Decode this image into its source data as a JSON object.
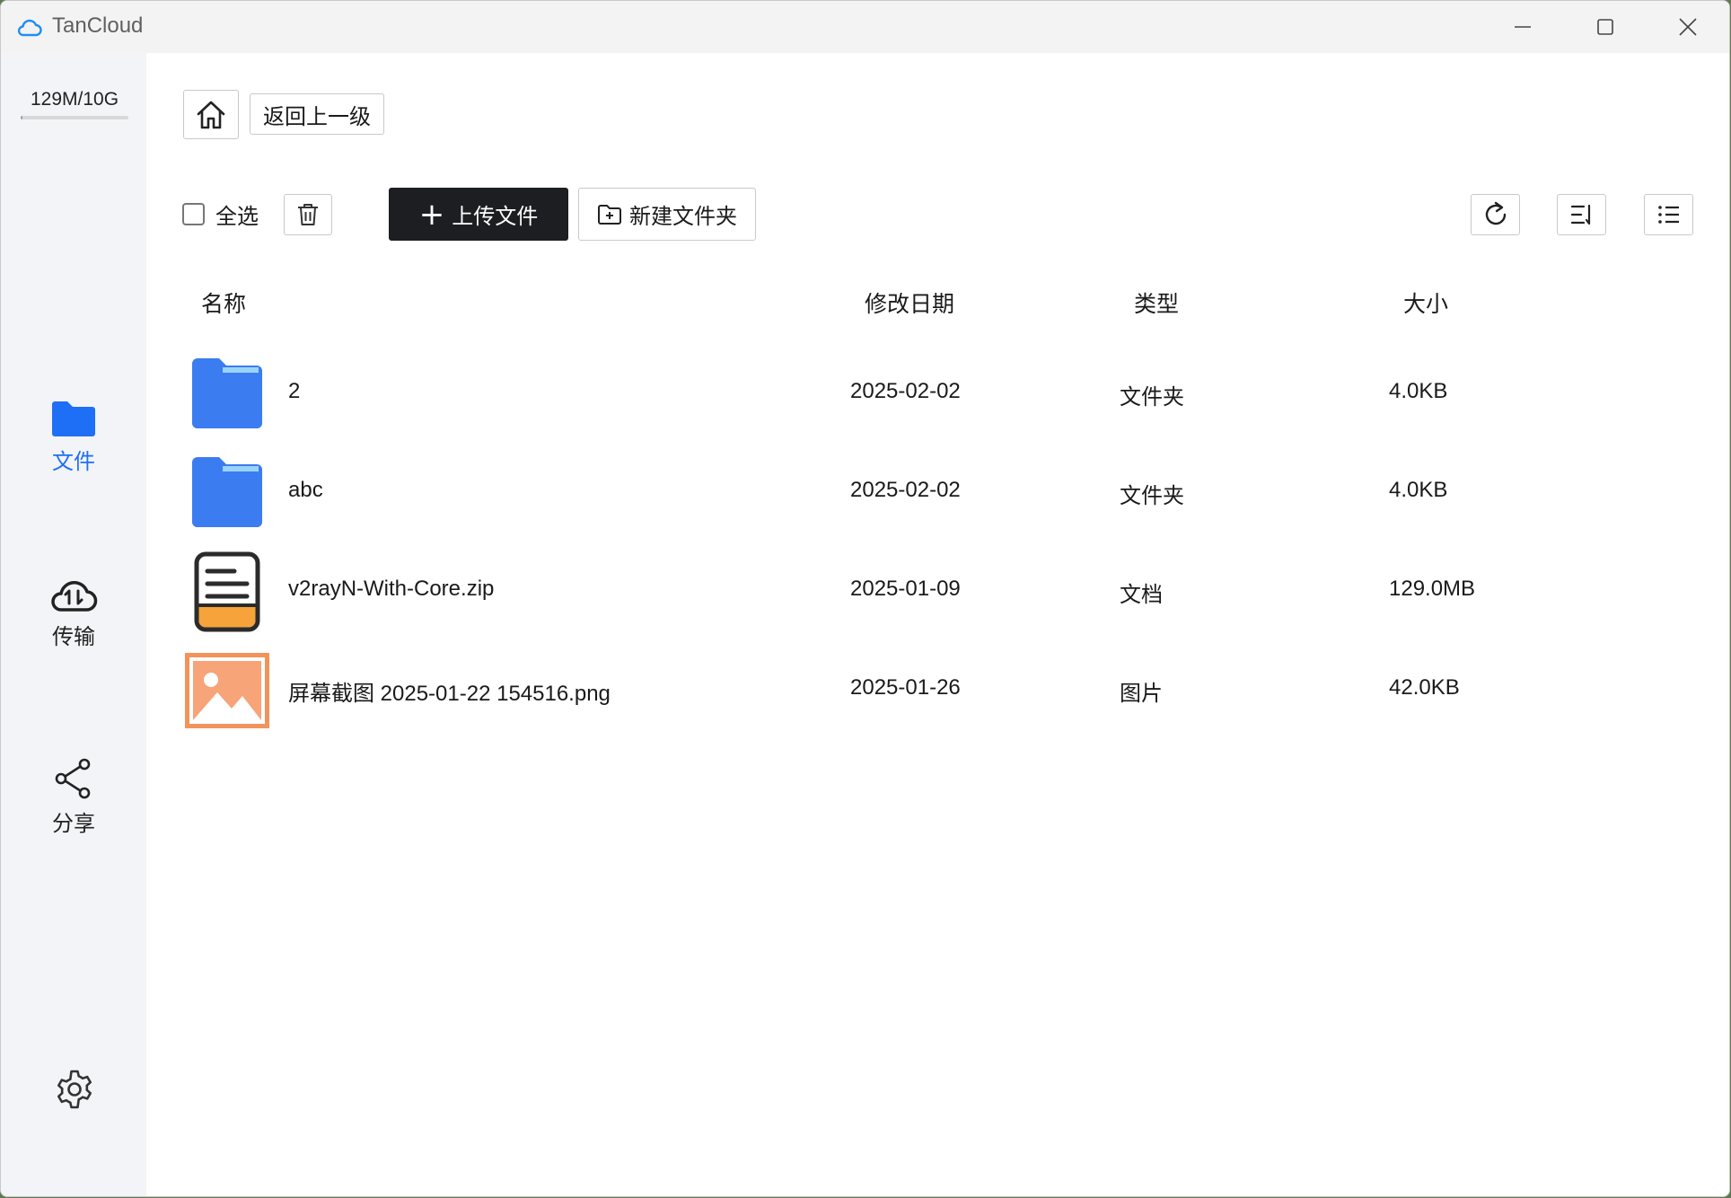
{
  "app": {
    "title": "TanCloud"
  },
  "sidebar": {
    "quota": "129M/10G",
    "quota_fraction": 0.0126,
    "items": [
      {
        "label": "文件",
        "icon": "folder-icon",
        "active": true
      },
      {
        "label": "传输",
        "icon": "cloud-transfer-icon",
        "active": false
      },
      {
        "label": "分享",
        "icon": "share-icon",
        "active": false
      }
    ],
    "settings_icon": "gear-icon"
  },
  "toolbar": {
    "back_label": "返回上一级",
    "select_all_label": "全选",
    "upload_label": "上传文件",
    "new_folder_label": "新建文件夹"
  },
  "table": {
    "headers": {
      "name": "名称",
      "date": "修改日期",
      "type": "类型",
      "size": "大小"
    },
    "rows": [
      {
        "name": "2",
        "date": "2025-02-02",
        "type": "文件夹",
        "size": "4.0KB",
        "icon": "folder-icon"
      },
      {
        "name": "abc",
        "date": "2025-02-02",
        "type": "文件夹",
        "size": "4.0KB",
        "icon": "folder-icon"
      },
      {
        "name": "v2rayN-With-Core.zip",
        "date": "2025-01-09",
        "type": "文档",
        "size": "129.0MB",
        "icon": "document-icon"
      },
      {
        "name": "屏幕截图 2025-01-22 154516.png",
        "date": "2025-01-26",
        "type": "图片",
        "size": "42.0KB",
        "icon": "image-icon"
      }
    ]
  },
  "colors": {
    "accent": "#1e6ff5",
    "folder": "#3b7cf0",
    "doc_orange": "#f5a33a",
    "image_orange": "#f2935c",
    "primary_button": "#1c1e21"
  }
}
